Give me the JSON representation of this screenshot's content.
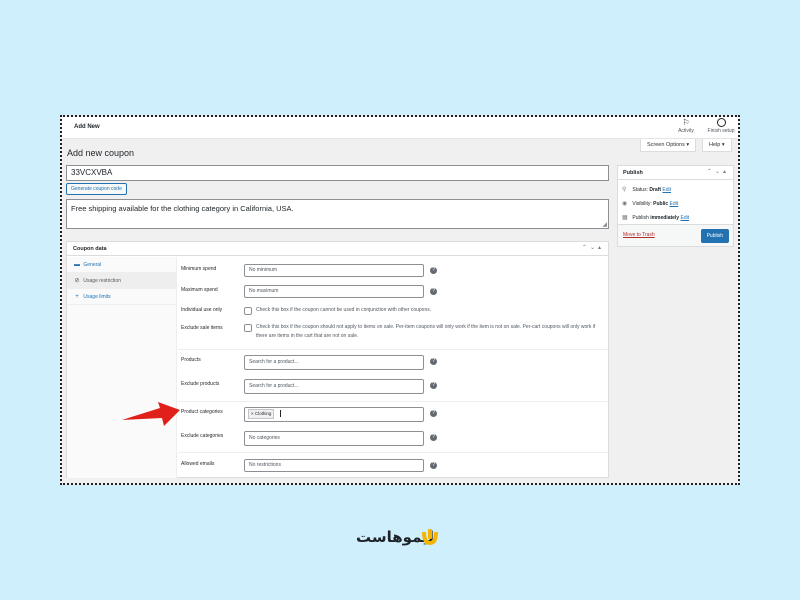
{
  "topbar": {
    "title": "Add New",
    "activity": "Activity",
    "finish_setup": "Finish setup"
  },
  "screen_options": "Screen Options ▾",
  "help": "Help ▾",
  "page_title": "Add new coupon",
  "coupon_code": "33VCXVBA",
  "generate_button": "Generate coupon code",
  "description": "Free shipping available for the clothing category in California, USA.",
  "coupon_data": {
    "title": "Coupon data",
    "tabs": [
      {
        "label": "General",
        "icon": "ticket-icon"
      },
      {
        "label": "Usage restriction",
        "icon": "restriction-icon"
      },
      {
        "label": "Usage limits",
        "icon": "plus-icon"
      }
    ],
    "fields": {
      "min_spend": {
        "label": "Minimum spend",
        "placeholder": "No minimum"
      },
      "max_spend": {
        "label": "Maximum spend",
        "placeholder": "No maximum"
      },
      "individual": {
        "label": "Individual use only",
        "text": "Check this box if the coupon cannot be used in conjunction with other coupons."
      },
      "exclude_sale": {
        "label": "Exclude sale items",
        "text": "Check this box if the coupon should not apply to items on sale. Per-item coupons will only work if the item is not on sale. Per-cart coupons will only work if there are items in the cart that are not on sale."
      },
      "products": {
        "label": "Products",
        "placeholder": "Search for a product…"
      },
      "exclude_products": {
        "label": "Exclude products",
        "placeholder": "Search for a product…"
      },
      "product_categories": {
        "label": "Product categories",
        "chip": "× Clothing"
      },
      "exclude_categories": {
        "label": "Exclude categories",
        "placeholder": "No categories"
      },
      "allowed_emails": {
        "label": "Allowed emails",
        "placeholder": "No restrictions"
      }
    }
  },
  "publish": {
    "title": "Publish",
    "status_label": "Status:",
    "status_value": "Draft",
    "visibility_label": "Visibility:",
    "visibility_value": "Public",
    "publish_label": "Publish",
    "publish_value": "immediately",
    "edit": "Edit",
    "trash": "Move to Trash",
    "button": "Publish"
  },
  "brand": {
    "name": "لیموهاست"
  },
  "colors": {
    "accent": "#2271b1",
    "arrow": "#e0201b",
    "background": "#cfeffd"
  }
}
